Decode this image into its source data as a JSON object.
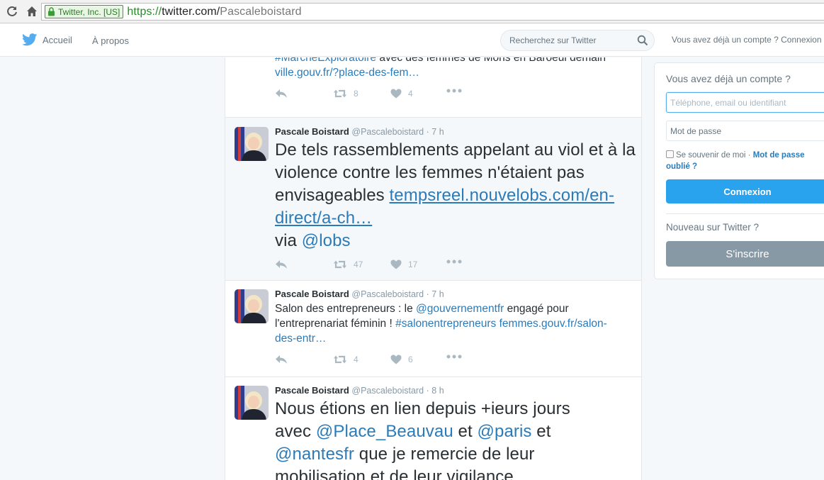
{
  "browser": {
    "ev_label": "Twitter, Inc. [US]",
    "url_protocol": "https://",
    "url_host": "twitter.com/",
    "url_path": "Pascaleboistard"
  },
  "topbar": {
    "home_label": "Accueil",
    "about_label": "À propos",
    "search_placeholder": "Recherchez sur Twitter",
    "account_prompt": "Vous avez déjà un compte ?",
    "login_label": "Connexion"
  },
  "tweets": [
    {
      "text_parts": [
        "#MarcheExploratoire",
        " avec des femmes de Mons en Baroeul demain",
        "ville.gouv.fr/?place-des-fem…"
      ],
      "retweets": "8",
      "likes": "4"
    },
    {
      "name": "Pascale Boistard",
      "handle": "@Pascaleboistard",
      "time": "· 7 h",
      "text_parts": [
        "De tels rassemblements appelant au viol et à la violence contre les femmes n'étaient pas envisageables",
        "tempsreel.nouvelobs.com/en-direct/a-ch…",
        "via ",
        "@lobs"
      ],
      "retweets": "47",
      "likes": "17"
    },
    {
      "name": "Pascale Boistard",
      "handle": "@Pascaleboistard",
      "time": "· 7 h",
      "text_parts": [
        "Salon des entrepreneurs : le ",
        "@gouvernementfr",
        "  engagé pour l'entreprenariat féminin ! ",
        "#salonentrepreneurs",
        " ",
        "femmes.gouv.fr/salon-des-entr…"
      ],
      "retweets": "4",
      "likes": "6"
    },
    {
      "name": "Pascale Boistard",
      "handle": "@Pascaleboistard",
      "time": "· 8 h",
      "text_parts": [
        "Nous étions en lien depuis +ieurs jours avec ",
        "@Place_Beauvau",
        " et ",
        "@paris",
        " et ",
        "@nantesfr",
        " que je remercie de leur mobilisation et de leur vigilance"
      ]
    }
  ],
  "login": {
    "title": "Vous avez déjà un compte ?",
    "username_placeholder": "Téléphone, email ou identifiant",
    "password_placeholder": "Mot de passe",
    "remember_label": "Se souvenir de moi",
    "separator": " · ",
    "forgot_label": "Mot de passe oublié ?",
    "login_button": "Connexion",
    "new_label": "Nouveau sur Twitter ?",
    "signup_button": "S'inscrire"
  },
  "colors": {
    "link": "#2b7bb9",
    "primary_button": "#2aa3ef",
    "signup_button": "#8899a6",
    "ev_green": "#3c9a37"
  },
  "icons": [
    "reload-icon",
    "home-icon",
    "lock-icon",
    "twitter-bird-icon",
    "search-icon",
    "reply-icon",
    "retweet-icon",
    "heart-icon",
    "more-icon"
  ]
}
